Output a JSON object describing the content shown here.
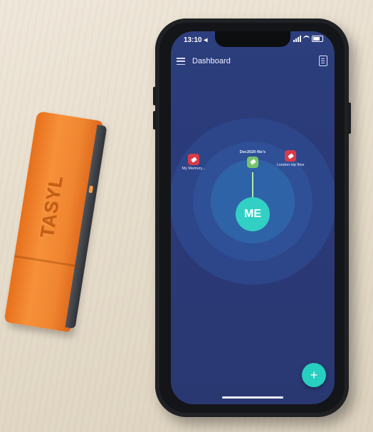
{
  "usb_stick": {
    "brand": "TASYL"
  },
  "phone": {
    "status_bar": {
      "time": "13:10 ◂"
    },
    "header": {
      "title": "Dashboard",
      "menu_icon": "hamburger-icon",
      "doc_icon": "document-icon"
    },
    "center_node": {
      "label": "ME"
    },
    "files": [
      {
        "label": "My Memory...",
        "color": "#d73b48"
      },
      {
        "label": "Dec2020 file's",
        "color": "#76c46b"
      },
      {
        "label": "London trip files",
        "color": "#d73b48"
      }
    ],
    "fab": {
      "symbol": "+"
    },
    "colors": {
      "background": "#2b3a78",
      "ring_outer": "#2d4589",
      "ring_mid": "#2f5096",
      "ring_inner": "#2f63a8",
      "accent": "#32d0c4"
    }
  }
}
